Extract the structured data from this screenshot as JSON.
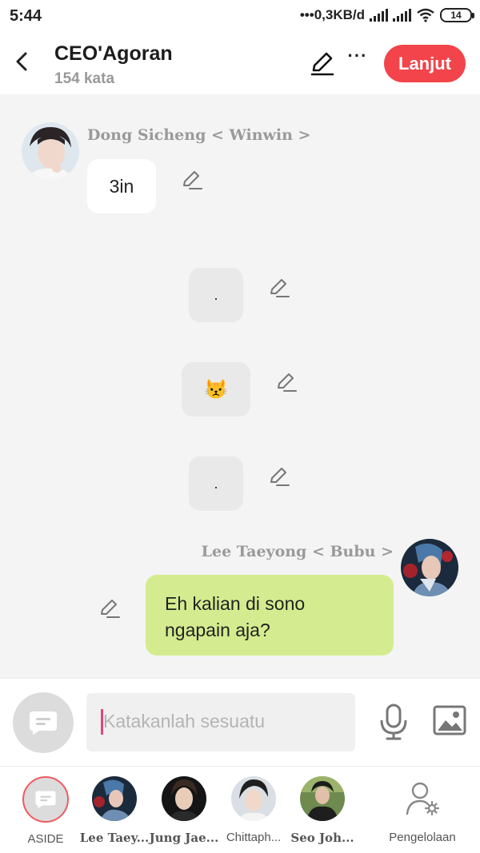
{
  "status_bar": {
    "time": "5:44",
    "network_speed": "0,3KB/d",
    "battery": "14"
  },
  "header": {
    "title": "CEO'Agoran",
    "subtitle": "154 kata",
    "next_label": "Lanjut"
  },
  "messages": [
    {
      "type": "incoming",
      "sender": "Dong Sicheng < Winwin >",
      "text": "3in"
    },
    {
      "type": "narration",
      "text": "."
    },
    {
      "type": "narration",
      "text": "😾"
    },
    {
      "type": "narration",
      "text": "."
    },
    {
      "type": "outgoing",
      "sender": "Lee Taeyong < Bubu >",
      "text": "Eh kalian di sono ngapain aja?"
    }
  ],
  "input": {
    "placeholder": "Katakanlah sesuatu"
  },
  "characters": [
    {
      "label": "ASIDE"
    },
    {
      "label": "Lee Taey..."
    },
    {
      "label": "Jung Jae..."
    },
    {
      "label": "Chittaph..."
    },
    {
      "label": "Seo Joh..."
    },
    {
      "label": "Pengelolaan"
    }
  ],
  "colors": {
    "accent": "#f2444a",
    "outgoing_bubble": "#d4ec8f",
    "incoming_bubble": "#ffffff",
    "narration_bubble": "#e9e9e9"
  }
}
